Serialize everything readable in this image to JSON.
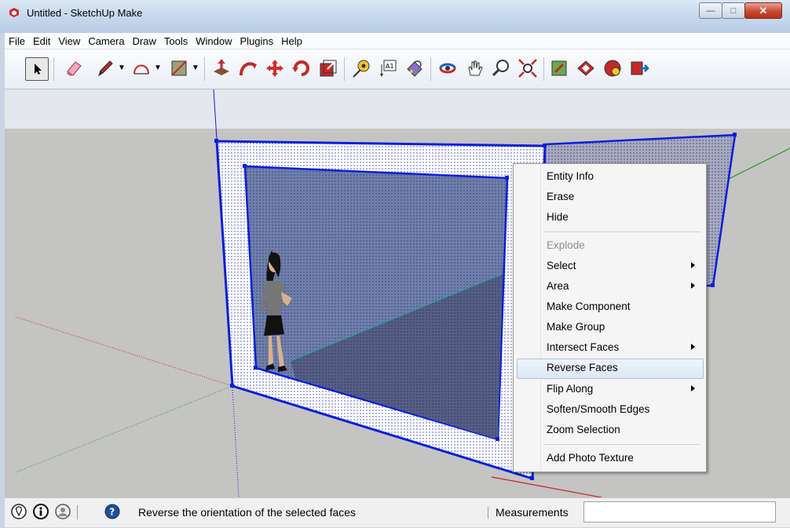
{
  "window": {
    "title": "Untitled - SketchUp Make"
  },
  "menubar": {
    "items": [
      "File",
      "Edit",
      "View",
      "Camera",
      "Draw",
      "Tools",
      "Window",
      "Plugins",
      "Help"
    ]
  },
  "toolbar": {
    "tools": [
      "select-icon",
      "eraser-icon",
      "pencil-icon",
      "arc-icon",
      "rectangle-icon",
      "push-pull-icon",
      "follow-me-icon",
      "move-icon",
      "rotate-icon",
      "scale-icon",
      "tape-measure-icon",
      "text-icon",
      "paint-bucket-icon",
      "orbit-icon",
      "pan-icon",
      "zoom-icon",
      "zoom-extents-icon",
      "previous-view-icon",
      "warehouse-icon",
      "components-icon",
      "share-model-icon"
    ]
  },
  "context_menu": {
    "items": [
      {
        "label": "Entity Info",
        "enabled": true,
        "submenu": false
      },
      {
        "label": "Erase",
        "enabled": true,
        "submenu": false
      },
      {
        "label": "Hide",
        "enabled": true,
        "submenu": false
      },
      {
        "label": "Explode",
        "enabled": false,
        "submenu": false
      },
      {
        "label": "Select",
        "enabled": true,
        "submenu": true
      },
      {
        "label": "Area",
        "enabled": true,
        "submenu": true
      },
      {
        "label": "Make Component",
        "enabled": true,
        "submenu": false
      },
      {
        "label": "Make Group",
        "enabled": true,
        "submenu": false
      },
      {
        "label": "Intersect Faces",
        "enabled": true,
        "submenu": true
      },
      {
        "label": "Reverse Faces",
        "enabled": true,
        "submenu": false,
        "highlighted": true
      },
      {
        "label": "Flip Along",
        "enabled": true,
        "submenu": true
      },
      {
        "label": "Soften/Smooth Edges",
        "enabled": true,
        "submenu": false
      },
      {
        "label": "Zoom Selection",
        "enabled": true,
        "submenu": false
      },
      {
        "label": "Add Photo Texture",
        "enabled": true,
        "submenu": false
      }
    ]
  },
  "statusbar": {
    "hint": "Reverse the orientation of the selected faces",
    "measurements_label": "Measurements",
    "measurements_value": ""
  },
  "colors": {
    "selection_blue": "#0a1edc",
    "face_blue": "#5a6ea8",
    "ground": "#c4c4c2",
    "sky": "#e4e8ee"
  }
}
